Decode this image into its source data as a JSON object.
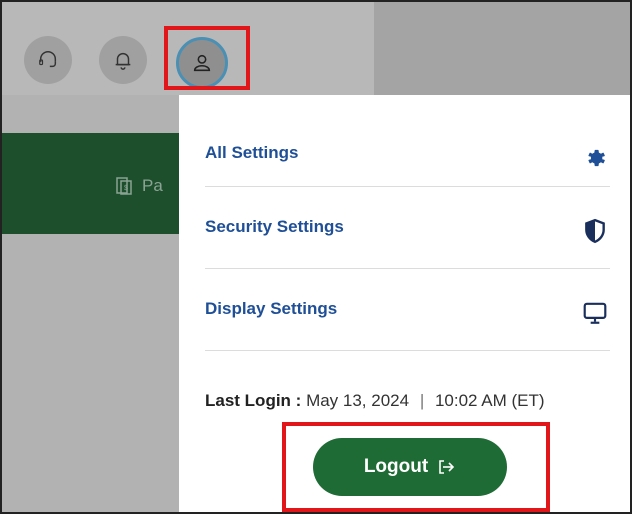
{
  "header": {
    "icons": [
      "headset-icon",
      "bell-icon",
      "user-icon"
    ]
  },
  "nav": {
    "partial_label": "Pa"
  },
  "menu": {
    "items": [
      {
        "label": "All Settings",
        "icon": "gear-icon"
      },
      {
        "label": "Security Settings",
        "icon": "shield-icon"
      },
      {
        "label": "Display Settings",
        "icon": "monitor-icon"
      }
    ]
  },
  "last_login": {
    "label": "Last Login :",
    "date": "May 13, 2024",
    "separator": "|",
    "time": "10:02 AM (ET)"
  },
  "logout": {
    "label": "Logout"
  },
  "colors": {
    "accent_green": "#1f6b35",
    "dark_green_bar": "#1e4f2c",
    "link_blue": "#1f4f96",
    "highlight_red": "#e0161b"
  }
}
